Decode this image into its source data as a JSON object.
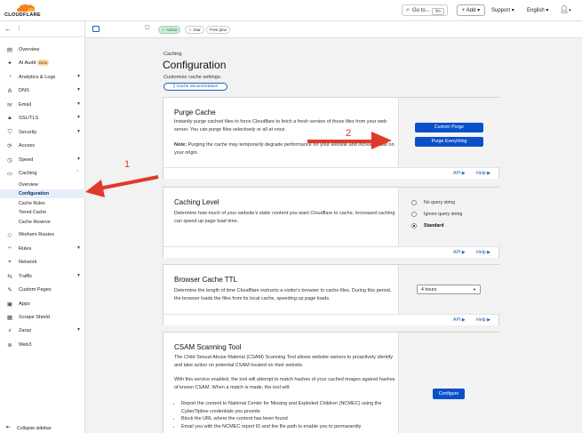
{
  "brand": {
    "name": "CLOUDFLARE"
  },
  "topbar": {
    "goto_label": "Go to...",
    "goto_shortcut": "⌘K",
    "add_label": "+ Add",
    "support_label": "Support",
    "language_label": "English"
  },
  "sidebar": {
    "items": [
      {
        "label": "Overview",
        "icon": "overview-icon"
      },
      {
        "label": "AI Audit",
        "icon": "ai-audit-icon",
        "badge": "Beta"
      },
      {
        "label": "Analytics & Logs",
        "icon": "analytics-icon"
      },
      {
        "label": "DNS",
        "icon": "dns-icon"
      },
      {
        "label": "Email",
        "icon": "email-icon"
      },
      {
        "label": "SSL/TLS",
        "icon": "lock-icon"
      },
      {
        "label": "Security",
        "icon": "shield-icon"
      },
      {
        "label": "Access",
        "icon": "access-icon"
      },
      {
        "label": "Speed",
        "icon": "speed-icon"
      },
      {
        "label": "Caching",
        "icon": "caching-icon"
      }
    ],
    "caching_sub": [
      "Overview",
      "Configuration",
      "Cache Rules",
      "Tiered Cache",
      "Cache Reserve"
    ],
    "items_after": [
      {
        "label": "Workers Routes",
        "icon": "workers-icon"
      },
      {
        "label": "Rules",
        "icon": "rules-icon"
      },
      {
        "label": "Network",
        "icon": "network-icon"
      },
      {
        "label": "Traffic",
        "icon": "traffic-icon"
      },
      {
        "label": "Custom Pages",
        "icon": "custom-pages-icon"
      },
      {
        "label": "Apps",
        "icon": "apps-icon"
      },
      {
        "label": "Scrape Shield",
        "icon": "scrape-shield-icon"
      },
      {
        "label": "Zaraz",
        "icon": "zaraz-icon"
      },
      {
        "label": "Web3",
        "icon": "web3-icon"
      }
    ],
    "collapse_label": "Collapse sidebar"
  },
  "subbar": {
    "status_badge": "✓ Active",
    "star_badge": "☆ Star",
    "plan_badge": "Free plan"
  },
  "page": {
    "eyebrow": "Caching",
    "title": "Configuration",
    "description": "Customize cache settings.",
    "doc_link": "Cache documentation"
  },
  "purge_cache": {
    "title": "Purge Cache",
    "description": "Instantly purge cached files to force Cloudflare to fetch a fresh version of those files from your web server. You can purge files selectively or all at once.",
    "note_label": "Note:",
    "note": " Purging the cache may temporarily degrade performance for your website and increase load on your origin.",
    "custom_button": "Custom Purge",
    "everything_button": "Purge Everything",
    "api_link": "API ▶",
    "help_link": "Help ▶"
  },
  "caching_level": {
    "title": "Caching Level",
    "description": "Determine how much of your website's static content you want Cloudflare to cache. Increased caching can speed up page load time.",
    "options": [
      "No query string",
      "Ignore query string",
      "Standard"
    ],
    "selected": "Standard",
    "api_link": "API ▶",
    "help_link": "Help ▶"
  },
  "browser_ttl": {
    "title": "Browser Cache TTL",
    "description": "Determine the length of time Cloudflare instructs a visitor's browser to cache files. During this period, the browser loads the files from its local cache, speeding up page loads.",
    "value": "4 hours",
    "api_link": "API ▶",
    "help_link": "Help ▶"
  },
  "csam": {
    "title": "CSAM Scanning Tool",
    "description": "The Child Sexual Abuse Material (CSAM) Scanning Tool allows website owners to proactively identify and take action on potential CSAM located on their website.",
    "description2": "With this service enabled, the tool will attempt to match hashes of your cached images against hashes of known CSAM. When a match is made, the tool will:",
    "bullets": [
      "Report the content to National Center for Missing and Exploited Children (NCMEC) using the CyberTipline credentials you provide",
      "Block the URL where the content has been found",
      "Email you with the NCMEC report ID and the file path to enable you to permanently"
    ],
    "configure_button": "Configure"
  },
  "annotations": {
    "one": "1",
    "two": "2"
  },
  "colors": {
    "accent": "#0a51c9",
    "brand_orange": "#f48120",
    "arrow_red": "#e03a2a"
  }
}
